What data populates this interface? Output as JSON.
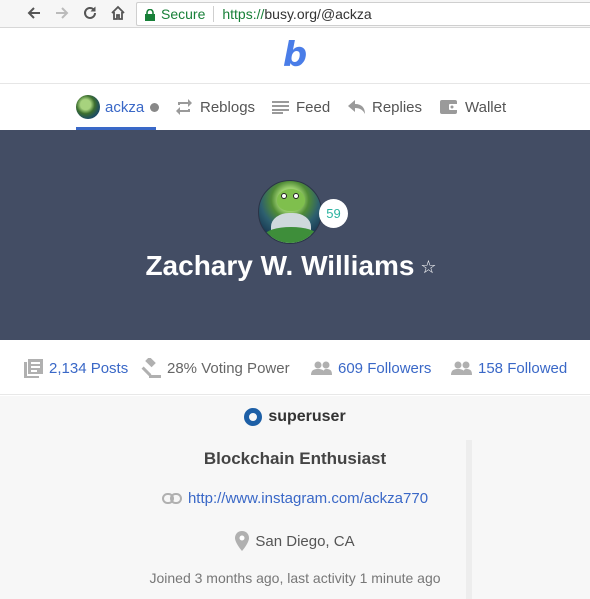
{
  "browser": {
    "secure_label": "Secure",
    "url_protocol": "https://",
    "url_rest": "busy.org/@ackza"
  },
  "site": {
    "logo": "b",
    "brand_color": "#4a7de8"
  },
  "tabs": [
    {
      "label": "ackza",
      "icon": "avatar",
      "active": true
    },
    {
      "label": "Reblogs",
      "icon": "reblog-icon"
    },
    {
      "label": "Feed",
      "icon": "feed-icon"
    },
    {
      "label": "Replies",
      "icon": "reply-icon"
    },
    {
      "label": "Wallet",
      "icon": "wallet-icon"
    }
  ],
  "profile": {
    "name": "Zachary W. Williams",
    "level": "59",
    "favorite_icon": "☆",
    "cover_color": "#434d64"
  },
  "stats": {
    "posts": "2,134 Posts",
    "voting_power": "28% Voting Power",
    "followers": "609 Followers",
    "followed": "158 Followed"
  },
  "about": {
    "rank": "superuser",
    "bio": "Blockchain Enthusiast",
    "website": "http://www.instagram.com/ackza770",
    "location": "San Diego, CA",
    "joined": "Joined 3 months ago, last activity 1 minute ago"
  }
}
